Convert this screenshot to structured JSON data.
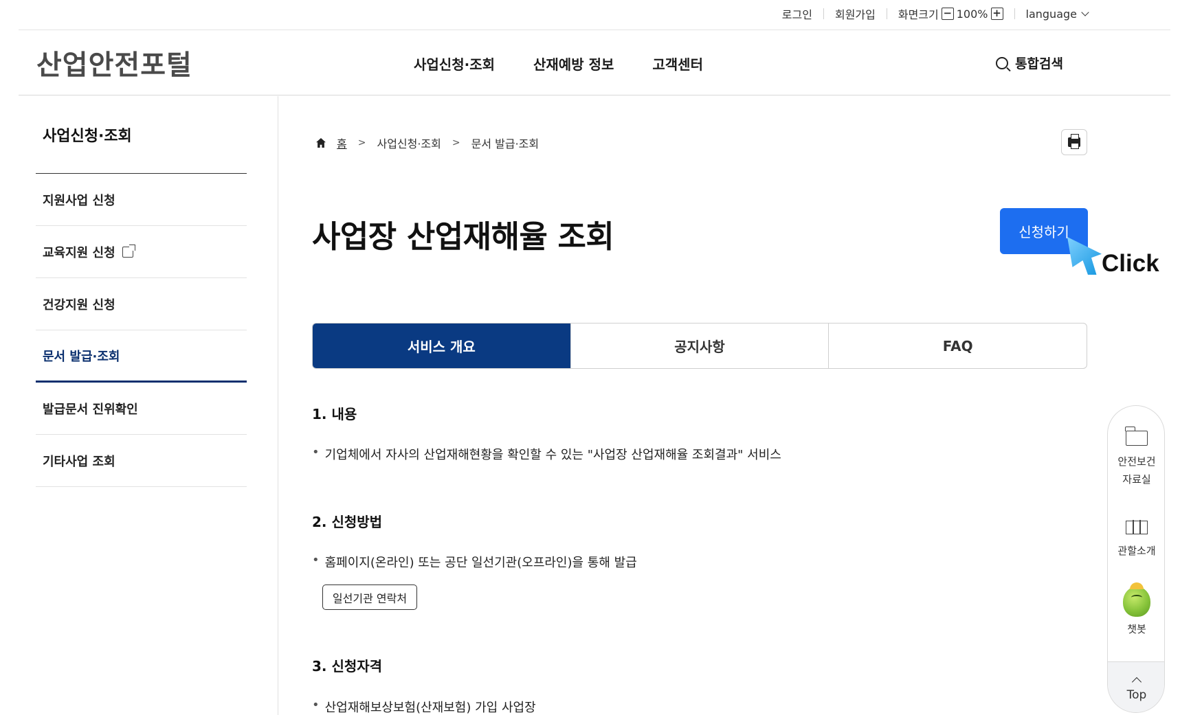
{
  "utility": {
    "login": "로그인",
    "signup": "회원가입",
    "zoom_label": "화면크기",
    "zoom_minus": "−",
    "zoom_value": "100%",
    "zoom_plus": "+",
    "language": "language"
  },
  "header": {
    "logo": "산업안전포털",
    "nav": [
      "사업신청·조회",
      "산재예방 정보",
      "고객센터"
    ],
    "search_label": "통합검색"
  },
  "sidebar": {
    "title": "사업신청·조회",
    "items": [
      {
        "label": "지원사업 신청"
      },
      {
        "label": "교육지원 신청"
      },
      {
        "label": "건강지원 신청"
      },
      {
        "label": "문서 발급·조회"
      },
      {
        "label": "발급문서 진위확인"
      },
      {
        "label": "기타사업 조회"
      }
    ],
    "active_index": 3
  },
  "breadcrumb": {
    "home": "홈",
    "level1": "사업신청·조회",
    "level2": "문서 발급·조회",
    "separator": ">"
  },
  "main": {
    "title": "사업장 산업재해율 조회",
    "apply_button": "신청하기",
    "click_annotation": "Click",
    "tabs": [
      "서비스 개요",
      "공지사항",
      "FAQ"
    ],
    "active_tab": 0,
    "sections": [
      {
        "title": "1. 내용",
        "bullet": "기업체에서 자사의 산업재해현황을 확인할 수 있는 \"사업장 산업재해율 조회결과\" 서비스"
      },
      {
        "title": "2. 신청방법",
        "bullet": "홈페이지(온라인) 또는 공단 일선기관(오프라인)을 통해 발급",
        "button": "일선기관 연락처"
      },
      {
        "title": "3. 신청자격",
        "bullet": "산업재해보상보험(산재보험) 가입 사업장"
      }
    ],
    "bullet_mark": "•"
  },
  "quick_menu": {
    "items": [
      {
        "label_line1": "안전보건",
        "label_line2": "자료실",
        "icon": "folder-icon"
      },
      {
        "label_line1": "관할소개",
        "icon": "map-icon"
      },
      {
        "label_line1": "챗봇",
        "icon": "chatbot-icon"
      }
    ],
    "top_label": "Top"
  },
  "colors": {
    "primary_button": "#1d6ef0",
    "active_tab": "#0a3a82",
    "active_sidebar": "#0a2f6e"
  }
}
